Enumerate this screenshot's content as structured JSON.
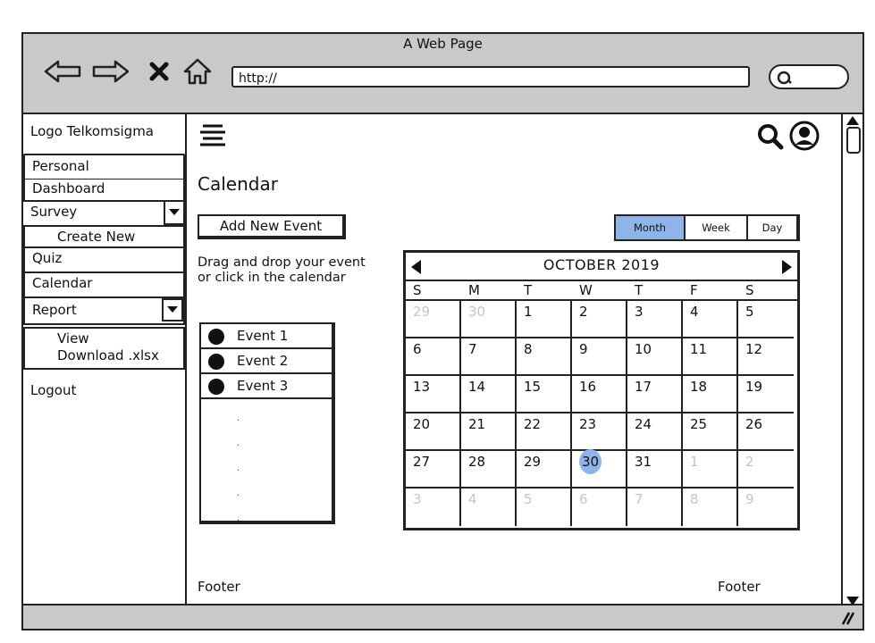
{
  "browser": {
    "title": "A Web Page",
    "url": "http://"
  },
  "sidebar": {
    "logo": "Logo Telkomsigma",
    "personal": "Personal",
    "dashboard": "Dashboard",
    "survey": "Survey",
    "survey_items": [
      "Create New"
    ],
    "quiz": "Quiz",
    "calendar": "Calendar",
    "report": "Report",
    "report_items": [
      "View",
      "Download .xlsx"
    ],
    "logout": "Logout"
  },
  "main": {
    "heading": "Calendar",
    "add_event_label": "Add New Event",
    "help_text": "Drag and drop your event or click in the calendar",
    "events": [
      "Event 1",
      "Event 2",
      "Event 3"
    ],
    "view_options": [
      "Month",
      "Week",
      "Day"
    ],
    "selected_view": "Month",
    "footer_left": "Footer",
    "footer_right": "Footer"
  },
  "calendar": {
    "month_label": "OCTOBER 2019",
    "weekdays": [
      "S",
      "M",
      "T",
      "W",
      "T",
      "F",
      "S"
    ],
    "weeks": [
      [
        "29",
        "30",
        "1",
        "2",
        "3",
        "4",
        "5"
      ],
      [
        "6",
        "7",
        "8",
        "9",
        "10",
        "11",
        "12"
      ],
      [
        "13",
        "14",
        "15",
        "16",
        "17",
        "18",
        "19"
      ],
      [
        "20",
        "21",
        "22",
        "23",
        "24",
        "25",
        "26"
      ],
      [
        "27",
        "28",
        "29",
        "30",
        "31",
        "1",
        "2"
      ],
      [
        "3",
        "4",
        "5",
        "6",
        "7",
        "8",
        "9"
      ]
    ],
    "today": "30",
    "highlight_color": "#8fb4ea"
  },
  "icons": [
    "back-arrow-icon",
    "forward-arrow-icon",
    "close-icon",
    "home-icon",
    "search-icon",
    "user-icon",
    "hamburger-menu-icon"
  ]
}
